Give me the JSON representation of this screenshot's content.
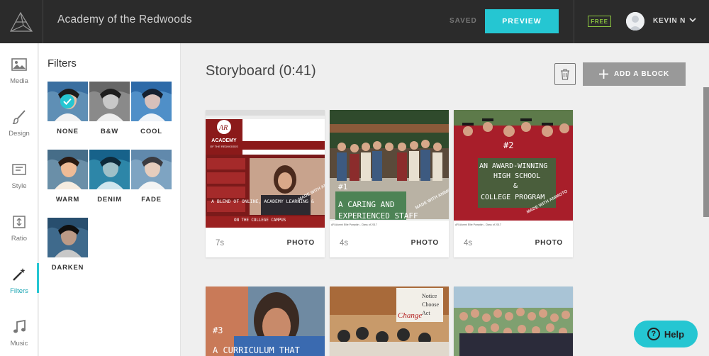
{
  "header": {
    "project_title": "Academy of the Redwoods",
    "saved_label": "SAVED",
    "preview_label": "PREVIEW",
    "plan_badge": "FREE",
    "user_name": "KEVIN N"
  },
  "sidebar": {
    "items": [
      {
        "label": "Media",
        "icon": "image-icon"
      },
      {
        "label": "Design",
        "icon": "brush-icon"
      },
      {
        "label": "Style",
        "icon": "text-style-icon"
      },
      {
        "label": "Ratio",
        "icon": "ratio-icon"
      },
      {
        "label": "Filters",
        "icon": "magic-wand-icon",
        "active": true
      },
      {
        "label": "Music",
        "icon": "music-note-icon"
      }
    ]
  },
  "filters_panel": {
    "title": "Filters",
    "filters": [
      {
        "label": "NONE",
        "selected": true
      },
      {
        "label": "B&W"
      },
      {
        "label": "COOL"
      },
      {
        "label": "WARM"
      },
      {
        "label": "DENIM"
      },
      {
        "label": "FADE"
      },
      {
        "label": "DARKEN"
      }
    ]
  },
  "storyboard": {
    "title": "Storyboard (0:41)",
    "add_block_label": "ADD A BLOCK",
    "cards": [
      {
        "duration": "7s",
        "type": "PHOTO",
        "overlay_text": [
          "A BLEND OF ONLINE, ACADEMY LEARNING &",
          "ON THE COLLEGE CAMPUS"
        ],
        "watermark": "MADE WITH ANIMOTO",
        "site_name": "ACADEMY",
        "site_sub": "OF THE REDWOODS"
      },
      {
        "duration": "4s",
        "type": "PHOTO",
        "overlay_text": [
          "#1",
          "A CARING AND",
          "EXPERIENCED STAFF"
        ],
        "watermark": "MADE WITH ANIMOTO",
        "caption": "AR Alumni Ellie Pumpkin - Class of 2017"
      },
      {
        "duration": "4s",
        "type": "PHOTO",
        "overlay_text": [
          "#2",
          "AN AWARD-WINNING",
          "HIGH SCHOOL",
          "&",
          "COLLEGE PROGRAM"
        ],
        "watermark": "MADE WITH ANIMOTO",
        "caption": "AR Alumni Ellie Pumpkin - Class of 2017"
      },
      {
        "overlay_text": [
          "#3",
          "A CURRICULUM THAT"
        ]
      },
      {
        "overlay_text": [
          "Notice",
          "Choose",
          "Act",
          "Change"
        ]
      },
      {
        "overlay_text": []
      }
    ]
  },
  "help": {
    "label": "Help"
  },
  "colors": {
    "accent": "#25c6d2",
    "topbar": "#2b2b2b",
    "free_badge": "#8ac43f"
  }
}
